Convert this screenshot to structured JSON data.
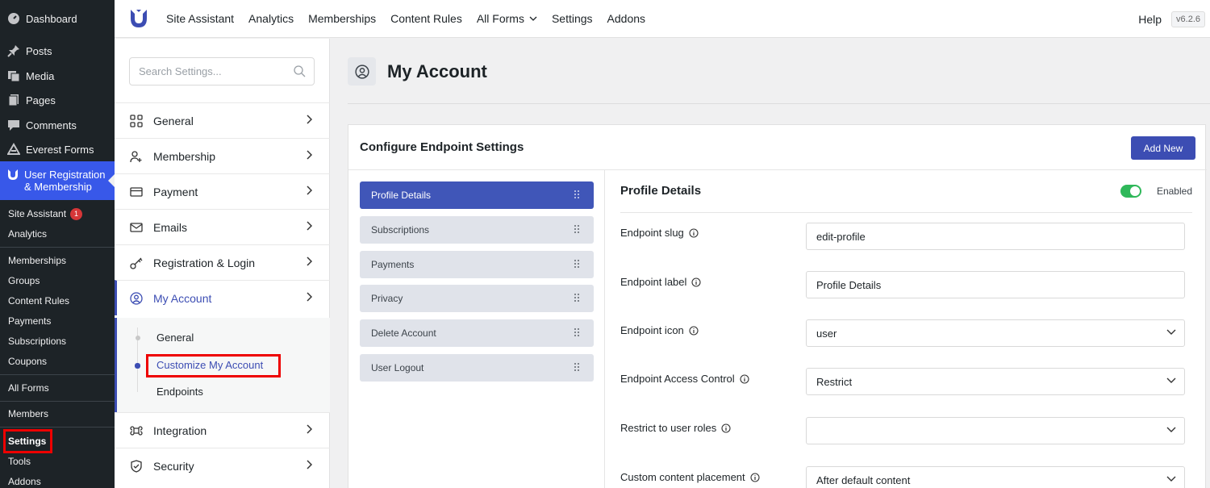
{
  "wp_sidebar": {
    "items": [
      {
        "label": "Dashboard",
        "icon": "dashboard-icon"
      },
      {
        "label": "Posts",
        "icon": "pin-icon"
      },
      {
        "label": "Media",
        "icon": "media-icon"
      },
      {
        "label": "Pages",
        "icon": "pages-icon"
      },
      {
        "label": "Comments",
        "icon": "comment-icon"
      },
      {
        "label": "Everest Forms",
        "icon": "everest-forms-icon"
      },
      {
        "label": "User Registration & Membership",
        "icon": "user-registration-icon"
      }
    ],
    "sub_items": [
      "Site Assistant",
      "Analytics",
      "Memberships",
      "Groups",
      "Content Rules",
      "Payments",
      "Subscriptions",
      "Coupons",
      "All Forms",
      "Members",
      "Settings",
      "Tools",
      "Addons"
    ],
    "site_assistant_badge": "1",
    "active_sub": "Settings",
    "accent_color": "#3858e9"
  },
  "topbar": {
    "nav": [
      "Site Assistant",
      "Analytics",
      "Memberships",
      "Content Rules",
      "All Forms",
      "Settings",
      "Addons"
    ],
    "help": "Help",
    "version": "v6.2.6"
  },
  "settings_nav": {
    "search_placeholder": "Search Settings...",
    "items": [
      {
        "label": "General",
        "icon": "grid-icon"
      },
      {
        "label": "Membership",
        "icon": "user-plus-icon"
      },
      {
        "label": "Payment",
        "icon": "card-icon"
      },
      {
        "label": "Emails",
        "icon": "mail-icon"
      },
      {
        "label": "Registration & Login",
        "icon": "key-icon"
      },
      {
        "label": "My Account",
        "icon": "user-circle-icon"
      },
      {
        "label": "Integration",
        "icon": "command-icon"
      },
      {
        "label": "Security",
        "icon": "shield-icon"
      }
    ],
    "my_account_sub": [
      "General",
      "Customize My Account",
      "Endpoints"
    ],
    "active_sub": "Customize My Account"
  },
  "main": {
    "title": "My Account",
    "card_title": "Configure Endpoint Settings",
    "add_new": "Add New",
    "endpoints": [
      "Profile Details",
      "Subscriptions",
      "Payments",
      "Privacy",
      "Delete Account",
      "User Logout"
    ],
    "selected_endpoint": "Profile Details",
    "detail": {
      "title": "Profile Details",
      "status": "Enabled",
      "fields": [
        {
          "label": "Endpoint slug",
          "value": "edit-profile",
          "type": "text"
        },
        {
          "label": "Endpoint label",
          "value": "Profile Details",
          "type": "text"
        },
        {
          "label": "Endpoint icon",
          "value": "user",
          "type": "select"
        },
        {
          "label": "Endpoint Access Control",
          "value": "Restrict",
          "type": "select"
        },
        {
          "label": "Restrict to user roles",
          "value": "",
          "type": "select"
        },
        {
          "label": "Custom content placement",
          "value": "After default content",
          "type": "select"
        }
      ]
    },
    "primary_color": "#3c4db3",
    "toggle_color": "#2fb85a"
  }
}
